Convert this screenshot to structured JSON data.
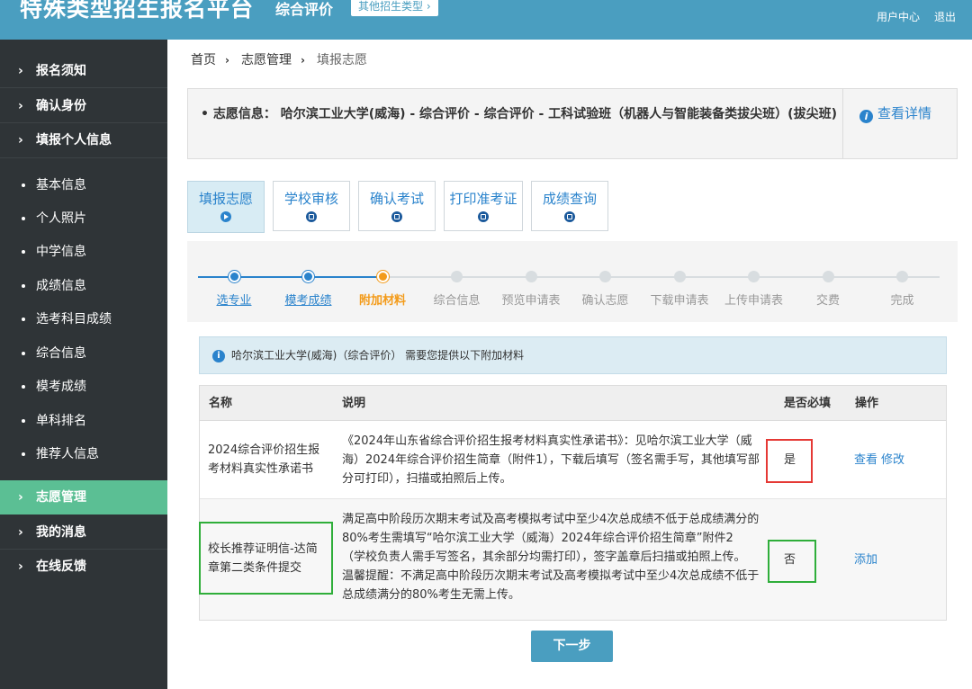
{
  "header": {
    "brand": "特殊类型招生报名平台",
    "subtitle": "综合评价",
    "other_type": "其他招生类型 ›",
    "user_center": "用户中心",
    "logout": "退出"
  },
  "sidebar": {
    "top_items": [
      {
        "label": "报名须知"
      },
      {
        "label": "确认身份"
      },
      {
        "label": "填报个人信息"
      }
    ],
    "sub_items": [
      {
        "label": "基本信息"
      },
      {
        "label": "个人照片"
      },
      {
        "label": "中学信息"
      },
      {
        "label": "成绩信息"
      },
      {
        "label": "选考科目成绩"
      },
      {
        "label": "综合信息"
      },
      {
        "label": "模考成绩"
      },
      {
        "label": "单科排名"
      },
      {
        "label": "推荐人信息"
      }
    ],
    "bottom_items": [
      {
        "label": "志愿管理",
        "active": true
      },
      {
        "label": "我的消息"
      },
      {
        "label": "在线反馈"
      }
    ],
    "chevron": "›"
  },
  "breadcrumb": {
    "items": [
      "首页",
      "志愿管理",
      "填报志愿"
    ],
    "separator": "›"
  },
  "choice_info": {
    "text": "• 志愿信息： 哈尔滨工业大学(威海) - 综合评价 - 综合评价 - 工科试验班（机器人与智能装备类拔尖班）(拔尖班)",
    "detail_link": "查看详情",
    "detail_icon": "i"
  },
  "tabs": [
    {
      "label": "填报志愿",
      "active": true,
      "icon": "play-icon"
    },
    {
      "label": "学校审核",
      "icon": "hourglass-icon"
    },
    {
      "label": "确认考试",
      "icon": "hourglass-icon"
    },
    {
      "label": "打印准考证",
      "icon": "hourglass-icon"
    },
    {
      "label": "成绩查询",
      "icon": "hourglass-icon"
    }
  ],
  "steps": [
    {
      "label": "选专业",
      "state": "done"
    },
    {
      "label": "模考成绩",
      "state": "done"
    },
    {
      "label": "附加材料",
      "state": "current"
    },
    {
      "label": "综合信息",
      "state": "todo"
    },
    {
      "label": "预览申请表",
      "state": "todo"
    },
    {
      "label": "确认志愿",
      "state": "todo"
    },
    {
      "label": "下载申请表",
      "state": "todo"
    },
    {
      "label": "上传申请表",
      "state": "todo"
    },
    {
      "label": "交费",
      "state": "todo"
    },
    {
      "label": "完成",
      "state": "todo"
    }
  ],
  "notice": {
    "icon": "i",
    "text": "哈尔滨工业大学(威海)（综合评价） 需要您提供以下附加材料"
  },
  "materials_table": {
    "headers": {
      "name": "名称",
      "desc": "说明",
      "required": "是否必填",
      "action": "操作"
    },
    "rows": [
      {
        "name_lines": [
          "2024综合评价招生报",
          "考材料真实性承诺书"
        ],
        "desc_lines": [
          "《2024年山东省综合评价招生报考材料真实性承诺书》：见哈尔滨工业大学（威",
          "海）2024年综合评价招生简章（附件1），下载后填写（签名需手写，其他填写部",
          "分可打印），扫描或拍照后上传。"
        ],
        "required": "是",
        "action_view": "查看",
        "action_edit": "修改"
      },
      {
        "name_lines": [
          "校长推荐证明信-达简",
          "章第二类条件提交"
        ],
        "desc_lines": [
          "满足高中阶段历次期末考试及高考模拟考试中至少4次总成绩不低于总成绩满分的",
          "80%考生需填写“哈尔滨工业大学（威海）2024年综合评价招生简章”附件2",
          "（学校负责人需手写签名，其余部分均需打印），签字盖章后扫描或拍照上传。",
          "温馨提醒：不满足高中阶段历次期末考试及高考模拟考试中至少4次总成绩不低于",
          "总成绩满分的80%考生无需上传。"
        ],
        "required": "否",
        "action_add": "添加"
      }
    ]
  },
  "next_button": "下一步",
  "colors": {
    "header": "#4a9ec0",
    "sidebar": "#2f3437",
    "sidebar_active": "#5bbf94",
    "link": "#2a83cc",
    "current_step": "#f39b1a",
    "highlight_red": "#e53935",
    "highlight_green": "#2fae3a"
  }
}
